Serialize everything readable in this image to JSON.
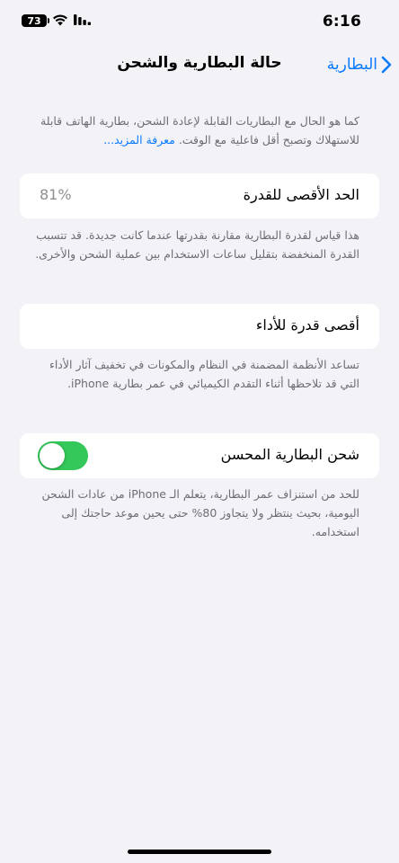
{
  "status_bar": {
    "time": "6:16",
    "battery_level": "73"
  },
  "nav": {
    "title": "حالة البطارية والشحن",
    "back_label": "البطارية"
  },
  "intro": {
    "text": "كما هو الحال مع البطاريات القابلة لإعادة الشحن، بطارية الهاتف قابلة للاستهلاك وتصبح أقل فاعلية مع الوقت.",
    "link": "معرفة المزيد..."
  },
  "max_capacity": {
    "label": "الحد الأقصى للقدرة",
    "value": "81%",
    "footer": "هذا قياس لقدرة البطارية مقارنة بقدرتها عندما كانت جديدة. قد تتسبب القدرة المنخفضة بتقليل ساعات الاستخدام بين عملية الشحن والأخرى."
  },
  "peak_performance": {
    "label": "أقصى قدرة للأداء",
    "footer": "تساعد الأنظمة المضمنة في النظام والمكونات في تخفيف آثار الأداء التي قد تلاحظها أثناء التقدم الكيميائي في عمر بطارية iPhone."
  },
  "optimized_charging": {
    "label": "شحن البطارية المحسن",
    "enabled": true,
    "footer": "للحد من استنزاف عمر البطارية، يتعلم الـ iPhone من عادات الشحن اليومية، بحيث ينتظر ولا يتجاوز 80% حتى يحين موعد حاجتك إلى استخدامه."
  },
  "colors": {
    "accent": "#0a7aff",
    "toggle_on": "#34c759",
    "background": "#f2f2f7"
  }
}
